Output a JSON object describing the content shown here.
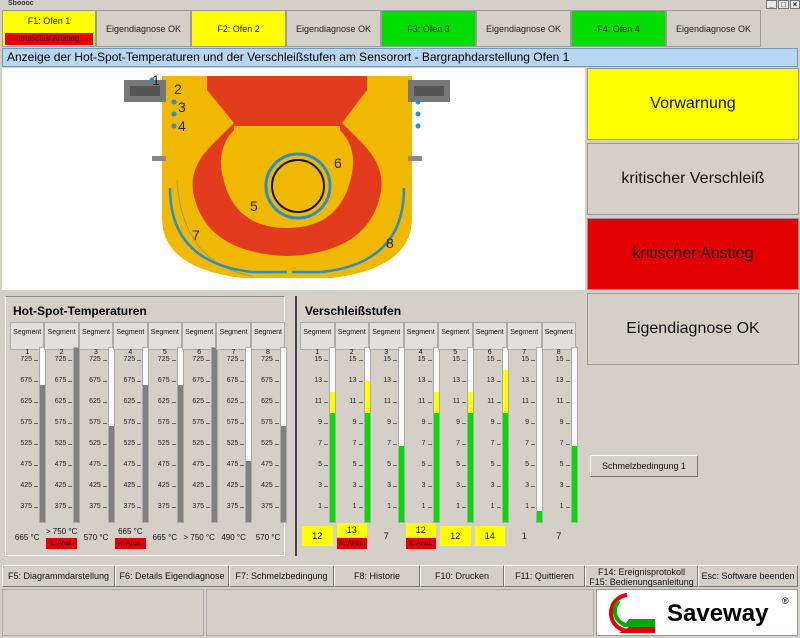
{
  "app_title": "Sboooc",
  "tabs": [
    {
      "label": "F1: Ofen 1",
      "sub": "kritischer Anstieg",
      "color": "#ffff00"
    },
    {
      "label": "Eigendiagnose OK",
      "color": "#d4d0c8"
    },
    {
      "label": "F2: Ofen 2",
      "color": "#ffff00"
    },
    {
      "label": "Eigendiagnose OK",
      "color": "#d4d0c8"
    },
    {
      "label": "F3: Ofen 3",
      "color": "#00dd00"
    },
    {
      "label": "Eigendiagnose OK",
      "color": "#d4d0c8"
    },
    {
      "label": "F4: Ofen 4",
      "color": "#00dd00"
    },
    {
      "label": "Eigendiagnose OK",
      "color": "#d4d0c8"
    }
  ],
  "banner": "Anzeige der Hot-Spot-Temperaturen und der Verschleißstufen am Sensorort - Bargraphdarstellung Ofen 1",
  "furnace_labels": [
    "1",
    "2",
    "3",
    "4",
    "5",
    "6",
    "7",
    "8"
  ],
  "status": [
    {
      "label": "Vorwarnung",
      "color": "#ffff00"
    },
    {
      "label": "kritischer Verschleiß",
      "color": "#d4d0c8"
    },
    {
      "label": "kritischer Anstieg",
      "color": "#e30000"
    },
    {
      "label": "Eigendiagnose OK",
      "color": "#d4d0c8"
    }
  ],
  "schmelz_button": "Schmelzbedingung 1",
  "hotspot": {
    "title": "Hot-Spot-Temperaturen",
    "ticks": [
      "725",
      "675",
      "625",
      "575",
      "525",
      "475",
      "425",
      "375"
    ],
    "segments": [
      "Segment 1",
      "Segment 2",
      "Segment 3",
      "Segment 4",
      "Segment 5",
      "Segment 6",
      "Segment 7",
      "Segment 8"
    ],
    "values": [
      "665 °C",
      "> 750 °C",
      "570 °C",
      "665 °C",
      "665 °C",
      "> 750 °C",
      "490 °C",
      "570 °C"
    ],
    "levels": [
      665,
      750,
      570,
      665,
      665,
      750,
      490,
      570
    ],
    "alerts": [
      "",
      "k. Anst.",
      "",
      "k. Anst.",
      "",
      "",
      "",
      ""
    ],
    "range": [
      350,
      750
    ]
  },
  "wear": {
    "title": "Verschleißstufen",
    "ticks": [
      "15",
      "13",
      "11",
      "9",
      "7",
      "5",
      "3",
      "1"
    ],
    "segments": [
      "Segment 1",
      "Segment 2",
      "Segment 3",
      "Segment 4",
      "Segment 5",
      "Segment 6",
      "Segment 7",
      "Segment 8"
    ],
    "values": [
      "12",
      "13",
      "7",
      "12",
      "12",
      "14",
      "1",
      "7"
    ],
    "levels": [
      12,
      13,
      7,
      12,
      12,
      14,
      1,
      7
    ],
    "alerts": [
      "",
      "k. Anst.",
      "",
      "k. Anst.",
      "",
      "",
      "",
      ""
    ],
    "value_colors": [
      "#ffff00",
      "#ffff00",
      "#d4d0c8",
      "#ffff00",
      "#ffff00",
      "#ffff00",
      "#d4d0c8",
      "#d4d0c8"
    ],
    "range": [
      0,
      16
    ],
    "warn_from": 10
  },
  "fkeys": [
    "F5: Diagrammdarstellung",
    "F6: Details Eigendiagnose",
    "F7: Schmelzbedingung",
    "F8: Historie",
    "F10: Drucken",
    "F11: Quittieren",
    "F14: Ereignisprotokoll",
    "F15: Bedienungsanleitung",
    "Esc: Software beenden"
  ],
  "logo": {
    "text": "Saveway",
    "mark": "®"
  },
  "colors": {
    "yellow": "#ffff00",
    "green": "#00dd00",
    "red": "#e30000",
    "furnace": "#f0b800",
    "furnace_inner": "#e23b1e",
    "blue": "#2a8fc8"
  }
}
